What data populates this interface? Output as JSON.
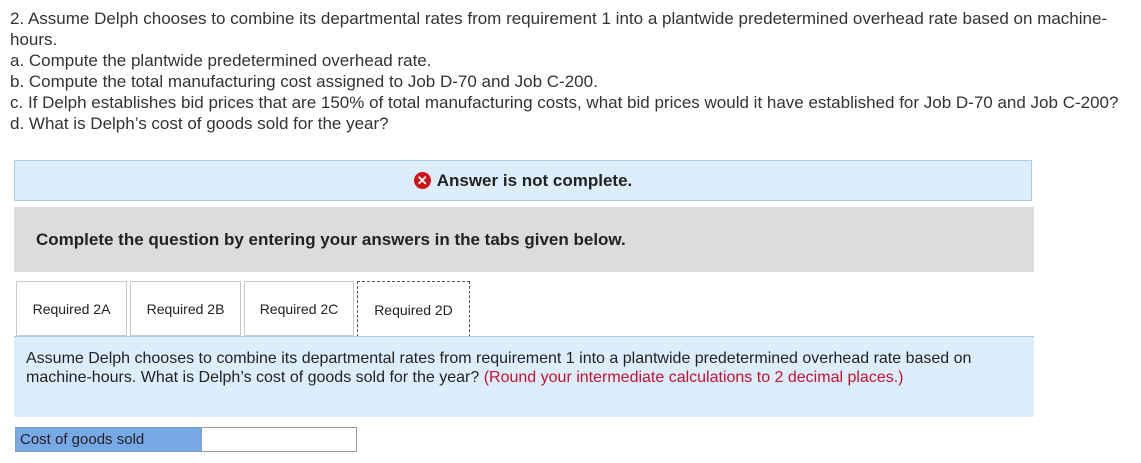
{
  "question": {
    "lines": [
      "2. Assume Delph chooses to combine its departmental rates from requirement 1 into a plantwide predetermined overhead rate based on machine-hours.",
      "a. Compute the plantwide predetermined overhead rate.",
      "b. Compute the total manufacturing cost assigned to Job D-70 and Job C-200.",
      "c. If Delph establishes bid prices that are 150% of total manufacturing costs, what bid prices would it have established for Job D-70 and Job C-200?",
      "d. What is Delph’s cost of goods sold for the year?"
    ]
  },
  "banner": {
    "icon": "x-circle-icon",
    "icon_glyph": "✕",
    "text": "Answer is not complete.",
    "icon_color": "#d0121b"
  },
  "instruction": "Complete the question by entering your answers in the tabs given below.",
  "tabs": [
    {
      "label": "Required 2A",
      "active": false
    },
    {
      "label": "Required 2B",
      "active": false
    },
    {
      "label": "Required 2C",
      "active": false
    },
    {
      "label": "Required 2D",
      "active": true
    }
  ],
  "panel": {
    "text": "Assume Delph chooses to combine its departmental rates from requirement 1 into a plantwide predetermined overhead rate based on machine-hours. What is Delph’s cost of goods sold for the year?",
    "note": "(Round your intermediate calculations to 2 decimal places.)",
    "note_color": "#c8102e"
  },
  "answer": {
    "label": "Cost of goods sold",
    "value": ""
  },
  "colors": {
    "banner_bg": "#dceefc",
    "instruction_bg": "#dcdcdc",
    "label_bg": "#76a9e6"
  }
}
